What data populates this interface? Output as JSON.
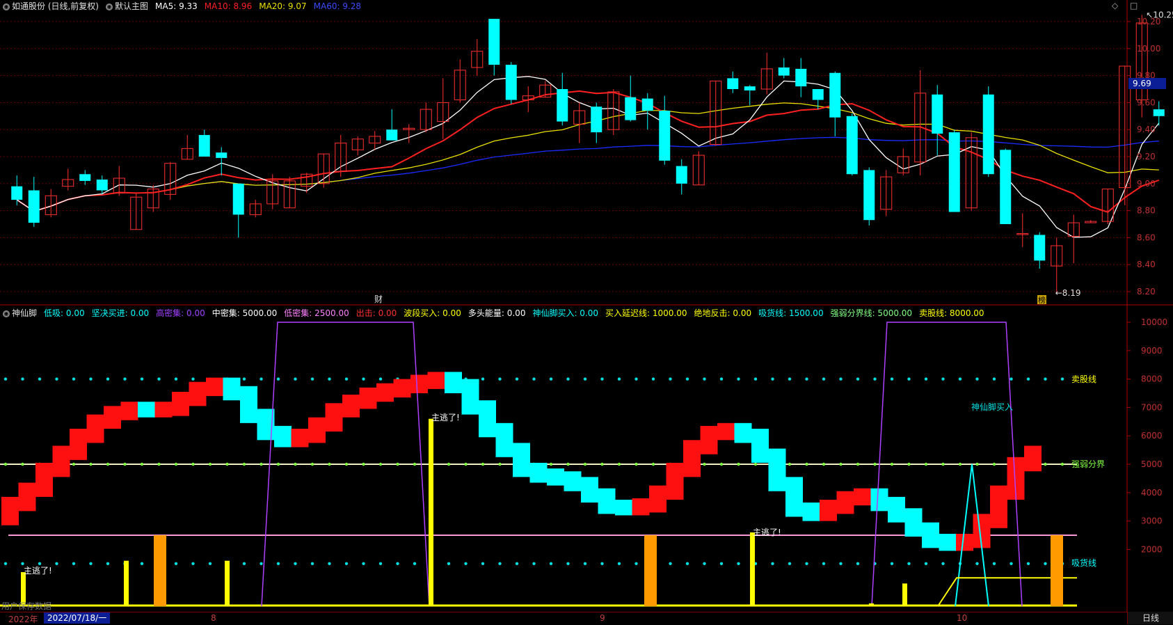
{
  "header": {
    "stock_title": "如通股份 (日线,前复权)",
    "template": "默认主图",
    "ma5": "MA5: 9.33",
    "ma10": "MA10: 8.96",
    "ma20": "MA20: 9.07",
    "ma60": "MA60: 9.28",
    "panel_toggle": "◇",
    "panel_close": "□"
  },
  "colors": {
    "ma5": "#ffffff",
    "ma10": "#ff2020",
    "ma20": "#e8e000",
    "ma60": "#1a2bff",
    "up": "#ff3030",
    "down": "#00ffff",
    "axis": "#b00000"
  },
  "price_axis": {
    "labels": [
      "10.20",
      "10.00",
      "9.80",
      "9.60",
      "9.40",
      "9.20",
      "9.00",
      "8.80",
      "8.60",
      "8.40",
      "8.20"
    ],
    "current_price": "9.69"
  },
  "main_chart": {
    "candles": [
      {
        "o": 8.98,
        "c": 8.88,
        "h": 9.06,
        "l": 8.84
      },
      {
        "o": 8.95,
        "c": 8.71,
        "h": 9.05,
        "l": 8.68
      },
      {
        "o": 8.77,
        "c": 8.91,
        "h": 8.96,
        "l": 8.75
      },
      {
        "o": 8.98,
        "c": 9.03,
        "h": 9.11,
        "l": 8.95
      },
      {
        "o": 9.07,
        "c": 9.02,
        "h": 9.1,
        "l": 8.99
      },
      {
        "o": 9.03,
        "c": 8.95,
        "h": 9.06,
        "l": 8.92
      },
      {
        "o": 8.93,
        "c": 9.04,
        "h": 9.13,
        "l": 8.91
      },
      {
        "o": 8.66,
        "c": 8.9,
        "h": 8.93,
        "l": 8.66
      },
      {
        "o": 8.82,
        "c": 8.96,
        "h": 8.99,
        "l": 8.79
      },
      {
        "o": 8.92,
        "c": 9.15,
        "h": 9.16,
        "l": 8.88
      },
      {
        "o": 9.18,
        "c": 9.26,
        "h": 9.36,
        "l": 9.18
      },
      {
        "o": 9.36,
        "c": 9.2,
        "h": 9.4,
        "l": 9.2
      },
      {
        "o": 9.23,
        "c": 9.19,
        "h": 9.27,
        "l": 9.06
      },
      {
        "o": 9.0,
        "c": 8.77,
        "h": 9.0,
        "l": 8.6
      },
      {
        "o": 8.77,
        "c": 8.85,
        "h": 8.88,
        "l": 8.75
      },
      {
        "o": 8.85,
        "c": 9.02,
        "h": 9.07,
        "l": 8.81
      },
      {
        "o": 8.82,
        "c": 9.02,
        "h": 9.05,
        "l": 8.82
      },
      {
        "o": 8.98,
        "c": 9.07,
        "h": 9.08,
        "l": 8.93
      },
      {
        "o": 9.0,
        "c": 9.22,
        "h": 9.22,
        "l": 8.97
      },
      {
        "o": 9.09,
        "c": 9.3,
        "h": 9.36,
        "l": 9.05
      },
      {
        "o": 9.25,
        "c": 9.33,
        "h": 9.35,
        "l": 9.21
      },
      {
        "o": 9.3,
        "c": 9.35,
        "h": 9.39,
        "l": 9.25
      },
      {
        "o": 9.4,
        "c": 9.32,
        "h": 9.55,
        "l": 9.32
      },
      {
        "o": 9.4,
        "c": 9.41,
        "h": 9.44,
        "l": 9.3
      },
      {
        "o": 9.4,
        "c": 9.55,
        "h": 9.6,
        "l": 9.38
      },
      {
        "o": 9.46,
        "c": 9.6,
        "h": 9.78,
        "l": 9.33
      },
      {
        "o": 9.62,
        "c": 9.84,
        "h": 9.92,
        "l": 9.6
      },
      {
        "o": 9.86,
        "c": 9.98,
        "h": 10.07,
        "l": 9.8
      },
      {
        "o": 10.22,
        "c": 9.88,
        "h": 10.22,
        "l": 9.8
      },
      {
        "o": 9.88,
        "c": 9.62,
        "h": 9.9,
        "l": 9.59
      },
      {
        "o": 9.62,
        "c": 9.65,
        "h": 9.72,
        "l": 9.53
      },
      {
        "o": 9.64,
        "c": 9.73,
        "h": 9.76,
        "l": 9.64
      },
      {
        "o": 9.7,
        "c": 9.46,
        "h": 9.82,
        "l": 9.43
      },
      {
        "o": 9.44,
        "c": 9.54,
        "h": 9.6,
        "l": 9.3
      },
      {
        "o": 9.57,
        "c": 9.38,
        "h": 9.6,
        "l": 9.3
      },
      {
        "o": 9.4,
        "c": 9.68,
        "h": 9.7,
        "l": 9.36
      },
      {
        "o": 9.64,
        "c": 9.47,
        "h": 9.8,
        "l": 9.46
      },
      {
        "o": 9.63,
        "c": 9.54,
        "h": 9.67,
        "l": 9.4
      },
      {
        "o": 9.54,
        "c": 9.17,
        "h": 9.65,
        "l": 9.14
      },
      {
        "o": 9.13,
        "c": 9.0,
        "h": 9.18,
        "l": 8.92
      },
      {
        "o": 8.99,
        "c": 9.21,
        "h": 9.24,
        "l": 8.99
      },
      {
        "o": 9.29,
        "c": 9.76,
        "h": 9.76,
        "l": 9.28
      },
      {
        "o": 9.78,
        "c": 9.7,
        "h": 9.83,
        "l": 9.67
      },
      {
        "o": 9.72,
        "c": 9.69,
        "h": 9.73,
        "l": 9.58
      },
      {
        "o": 9.7,
        "c": 9.85,
        "h": 9.97,
        "l": 9.66
      },
      {
        "o": 9.86,
        "c": 9.8,
        "h": 9.93,
        "l": 9.78
      },
      {
        "o": 9.85,
        "c": 9.72,
        "h": 9.93,
        "l": 9.64
      },
      {
        "o": 9.7,
        "c": 9.62,
        "h": 9.68,
        "l": 9.55
      },
      {
        "o": 9.82,
        "c": 9.49,
        "h": 9.83,
        "l": 9.35
      },
      {
        "o": 9.5,
        "c": 9.07,
        "h": 9.52,
        "l": 9.06
      },
      {
        "o": 9.1,
        "c": 8.73,
        "h": 9.12,
        "l": 8.69
      },
      {
        "o": 8.81,
        "c": 9.05,
        "h": 9.1,
        "l": 8.76
      },
      {
        "o": 9.08,
        "c": 9.2,
        "h": 9.26,
        "l": 9.06
      },
      {
        "o": 9.16,
        "c": 9.67,
        "h": 9.84,
        "l": 9.06
      },
      {
        "o": 9.66,
        "c": 9.37,
        "h": 9.73,
        "l": 9.21
      },
      {
        "o": 9.38,
        "c": 8.79,
        "h": 9.4,
        "l": 8.79
      },
      {
        "o": 8.82,
        "c": 9.34,
        "h": 9.38,
        "l": 8.8
      },
      {
        "o": 9.66,
        "c": 9.07,
        "h": 9.72,
        "l": 9.05
      },
      {
        "o": 9.25,
        "c": 8.7,
        "h": 9.26,
        "l": 8.7
      },
      {
        "o": 8.63,
        "c": 8.63,
        "h": 8.78,
        "l": 8.53
      },
      {
        "o": 8.62,
        "c": 8.43,
        "h": 8.64,
        "l": 8.37
      },
      {
        "o": 8.39,
        "c": 8.54,
        "h": 8.6,
        "l": 8.19
      },
      {
        "o": 8.61,
        "c": 8.71,
        "h": 8.77,
        "l": 8.41
      },
      {
        "o": 8.71,
        "c": 8.72,
        "h": 8.73,
        "l": 8.71
      },
      {
        "o": 8.72,
        "c": 8.96,
        "h": 8.96,
        "l": 8.7
      },
      {
        "o": 8.97,
        "c": 9.87,
        "h": 9.87,
        "l": 8.84
      },
      {
        "o": 9.62,
        "c": 10.19,
        "h": 10.25,
        "l": 9.49
      },
      {
        "o": 9.55,
        "c": 9.5,
        "h": 9.61,
        "l": 9.43
      }
    ],
    "max_label": "10.25",
    "min_label": "8.19",
    "marker_cai": "财",
    "marker_ban": "榜"
  },
  "indicator": {
    "name": "神仙脚",
    "params": [
      {
        "text": "低吸: 0.00",
        "color": "#00ffff"
      },
      {
        "text": "坚决买进: 0.00",
        "color": "#00ffff"
      },
      {
        "text": "高密集: 0.00",
        "color": "#a040ff"
      },
      {
        "text": "中密集: 5000.00",
        "color": "#ffffff"
      },
      {
        "text": "低密集: 2500.00",
        "color": "#ff80ff"
      },
      {
        "text": "出击: 0.00",
        "color": "#ff3030"
      },
      {
        "text": "波段买入: 0.00",
        "color": "#ffff00"
      },
      {
        "text": "多头能量: 0.00",
        "color": "#ffffff"
      },
      {
        "text": "神仙脚买入: 0.00",
        "color": "#00ffff"
      },
      {
        "text": "买入延迟线: 1000.00",
        "color": "#ffff00"
      },
      {
        "text": "绝地反击: 0.00",
        "color": "#ffff00"
      },
      {
        "text": "吸货线: 1500.00",
        "color": "#00ffff"
      },
      {
        "text": "强弱分界线: 5000.00",
        "color": "#80ff80"
      },
      {
        "text": "卖股线: 8000.00",
        "color": "#ffff00"
      }
    ],
    "axis_labels": [
      "10000",
      "9000",
      "8000",
      "7000",
      "6000",
      "5000",
      "4000",
      "3000",
      "2000"
    ],
    "levels": [
      3600,
      4100,
      4800,
      5400,
      6000,
      6500,
      6800,
      6950,
      6900,
      6950,
      7300,
      7650,
      7800,
      7500,
      6700,
      6100,
      5850,
      6000,
      6400,
      6900,
      7200,
      7450,
      7600,
      7750,
      7900,
      8000,
      7750,
      7000,
      6200,
      5500,
      4800,
      4600,
      4500,
      4300,
      3900,
      3500,
      3450,
      3550,
      4000,
      4800,
      5600,
      6100,
      6200,
      6000,
      5300,
      4300,
      3400,
      3250,
      3500,
      3800,
      3900,
      3600,
      3200,
      2700,
      2300,
      2200,
      2300,
      3000,
      4000,
      5000,
      5400
    ],
    "bars_yellow": [
      [
        1,
        1200
      ],
      [
        7,
        1600
      ],
      [
        13,
        1600
      ],
      [
        25,
        6600
      ],
      [
        44,
        2600
      ],
      [
        52,
        100
      ],
      [
        53,
        800
      ]
    ],
    "bars_orange": [
      [
        9,
        2500
      ],
      [
        38,
        2500
      ],
      [
        62,
        2500
      ]
    ],
    "label_run1": "主逃了!",
    "label_run2": "主逃了!",
    "label_run3": "主逃了!",
    "label_sell": "卖股线",
    "label_strong": "强弱分界",
    "label_buy": "吸货线",
    "label_xianjiao": "神仙脚买入"
  },
  "bottom": {
    "year": "2022年",
    "date": "2022/07/18/一",
    "m8": "8",
    "m9": "9",
    "m10": "10",
    "period": "日线",
    "note": "用户保存数据"
  }
}
